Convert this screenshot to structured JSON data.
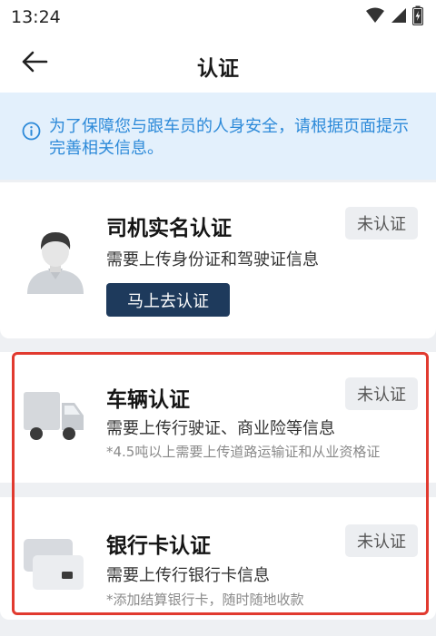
{
  "status_bar": {
    "time": "13:24",
    "icons": [
      "wifi-icon",
      "signal-icon",
      "battery-charging-icon"
    ]
  },
  "header": {
    "title": "认证",
    "back_icon": "arrow-left-icon"
  },
  "notice": {
    "icon": "info-circle-icon",
    "text": "为了保障您与跟车员的人身安全，请根据页面提示完善相关信息。"
  },
  "cards": [
    {
      "title": "司机实名认证",
      "description": "需要上传身份证和驾驶证信息",
      "status": "未认证",
      "action": "马上去认证",
      "icon": "driver-avatar-icon"
    },
    {
      "title": "车辆认证",
      "description": "需要上传行驶证、商业险等信息",
      "note": "*4.5吨以上需要上传道路运输证和从业资格证",
      "status": "未认证",
      "icon": "truck-icon"
    },
    {
      "title": "银行卡认证",
      "description": "需要上传行银行卡信息",
      "note": "*添加结算银行卡，随时随地收款",
      "status": "未认证",
      "icon": "bank-card-icon"
    }
  ],
  "colors": {
    "notice_background": "#e3f0fc",
    "notice_text": "#2d8ad9",
    "primary_button": "#1e3a5c",
    "highlight_border": "#e13a2f"
  }
}
